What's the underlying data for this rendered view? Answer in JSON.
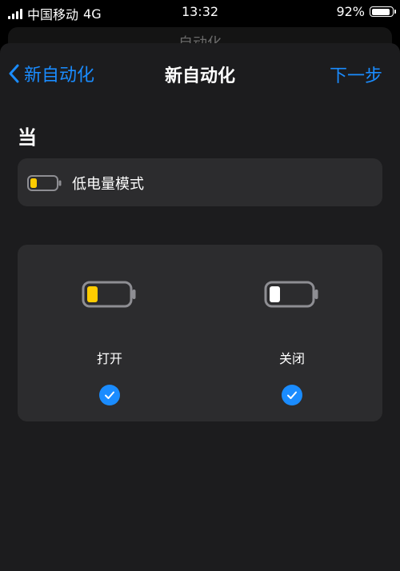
{
  "status_bar": {
    "carrier": "中国移动",
    "network": "4G",
    "time": "13:32",
    "battery_percent_text": "92%",
    "battery_level": 0.92
  },
  "behind_title": "自动化",
  "nav": {
    "back_label": "新自动化",
    "title": "新自动化",
    "next_label": "下一步"
  },
  "section_label": "当",
  "trigger": {
    "label": "低电量模式",
    "icon": "battery-icon"
  },
  "options": [
    {
      "label": "打开",
      "icon": "battery-low-yellow-icon",
      "selected": true
    },
    {
      "label": "关闭",
      "icon": "battery-low-white-icon",
      "selected": true
    }
  ],
  "colors": {
    "accent": "#1a8cff",
    "low_power": "#ffcc00",
    "sheet_bg": "#1c1c1e",
    "card_bg": "#2c2c2e"
  }
}
